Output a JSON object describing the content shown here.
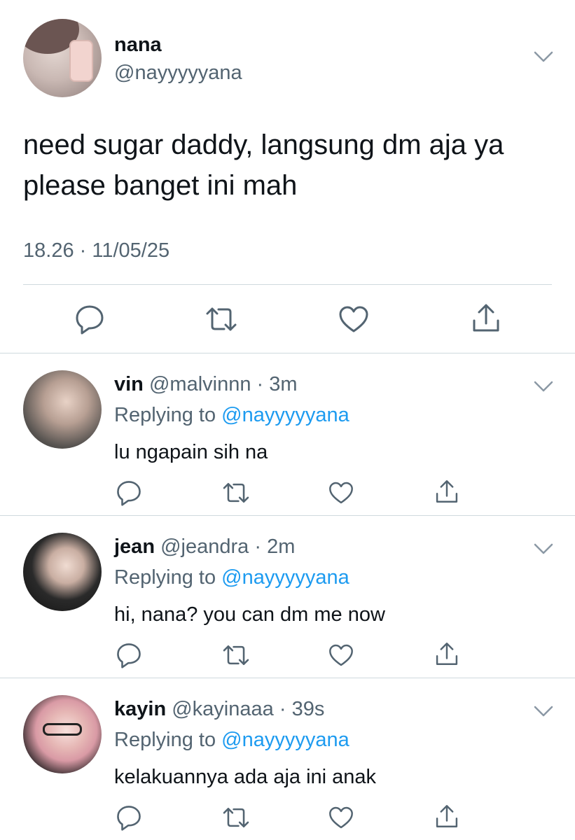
{
  "main": {
    "name": "nana",
    "handle": "@nayyyyyana",
    "text_line1": "need sugar daddy, langsung dm aja ya",
    "text_line2": "please banget ini mah",
    "time": "18.26 · 11/05/25"
  },
  "replies": [
    {
      "name": "vin",
      "handle": "@malvinnn",
      "dot": "·",
      "age": "3m",
      "replying_prefix": "Replying to ",
      "replying_to": "@nayyyyyana",
      "text": "lu ngapain sih na"
    },
    {
      "name": "jean",
      "handle": "@jeandra",
      "dot": "·",
      "age": "2m",
      "replying_prefix": "Replying to ",
      "replying_to": "@nayyyyyana",
      "text": "hi, nana? you can dm me now"
    },
    {
      "name": "kayin",
      "handle": "@kayinaaa",
      "dot": "·",
      "age": "39s",
      "replying_prefix": "Replying to ",
      "replying_to": "@nayyyyyana",
      "text": "kelakuannya ada aja ini anak"
    }
  ],
  "icons": {
    "reply": "reply-icon",
    "retweet": "retweet-icon",
    "like": "like-icon",
    "share": "share-icon",
    "more": "chevron-down-icon"
  },
  "colors": {
    "text": "#0f1419",
    "secondary": "#536471",
    "link": "#1d9bf0",
    "divider": "#cfd9de"
  }
}
